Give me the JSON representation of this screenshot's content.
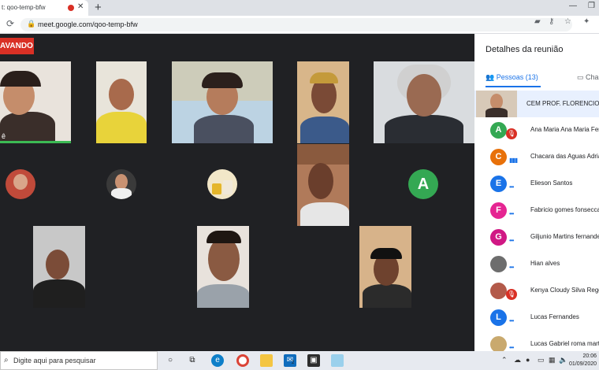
{
  "browser": {
    "tab_title": "t: qoo-temp-bfw",
    "tab_close": "✕",
    "new_tab": "+",
    "url": "meet.google.com/qoo-temp-bfw",
    "reload_icon": "reload-icon",
    "lock_icon": "lock-icon",
    "win_min": "—",
    "win_max": "❐"
  },
  "meet": {
    "recording_label": "AVANDO",
    "self_name_tag": "ê",
    "tiles": [
      {
        "kind": "video",
        "label": "Você"
      },
      {
        "kind": "video"
      },
      {
        "kind": "video"
      },
      {
        "kind": "video"
      },
      {
        "kind": "video"
      },
      {
        "kind": "avatar"
      },
      {
        "kind": "avatar"
      },
      {
        "kind": "avatar"
      },
      {
        "kind": "video"
      },
      {
        "kind": "letter",
        "letter": "A"
      },
      {
        "kind": "video"
      },
      {
        "kind": "video"
      },
      {
        "kind": "video"
      }
    ]
  },
  "panel": {
    "title": "Detalhes da reunião",
    "people_tab": "Pessoas (13)",
    "chat_tab": "Cha",
    "host_name": "CEM PROF. FLORENCIO AI",
    "participants": [
      {
        "name": "Ana Maria Ana Maria Ferra",
        "letter": "A",
        "color": "#34a853",
        "status": "muted"
      },
      {
        "name": "Chacara das Aguas Adria",
        "letter": "C",
        "color": "#e8710a",
        "status": "speaking"
      },
      {
        "name": "Elieson Santos",
        "letter": "E",
        "color": "#1a73e8",
        "status": "idle"
      },
      {
        "name": "Fabricio gomes fonsecca",
        "letter": "F",
        "color": "#e52592",
        "status": "idle"
      },
      {
        "name": "Giljunio Martins fernande",
        "letter": "G",
        "color": "#d01884",
        "status": "idle"
      },
      {
        "name": "Hian alves",
        "letter": "",
        "color": "#6d6d6d",
        "status": "idle"
      },
      {
        "name": "Kenya Cloudy Silva Rego",
        "letter": "",
        "color": "#b35a4a",
        "status": "muted"
      },
      {
        "name": "Lucas Fernandes",
        "letter": "L",
        "color": "#1a73e8",
        "status": "idle"
      },
      {
        "name": "Lucas Gabriel roma mart",
        "letter": "",
        "color": "#c9a96e",
        "status": "idle"
      }
    ]
  },
  "taskbar": {
    "search_placeholder": "Digite aqui para pesquisar",
    "time": "20:06",
    "date": "01/09/2020",
    "badge": "2"
  }
}
